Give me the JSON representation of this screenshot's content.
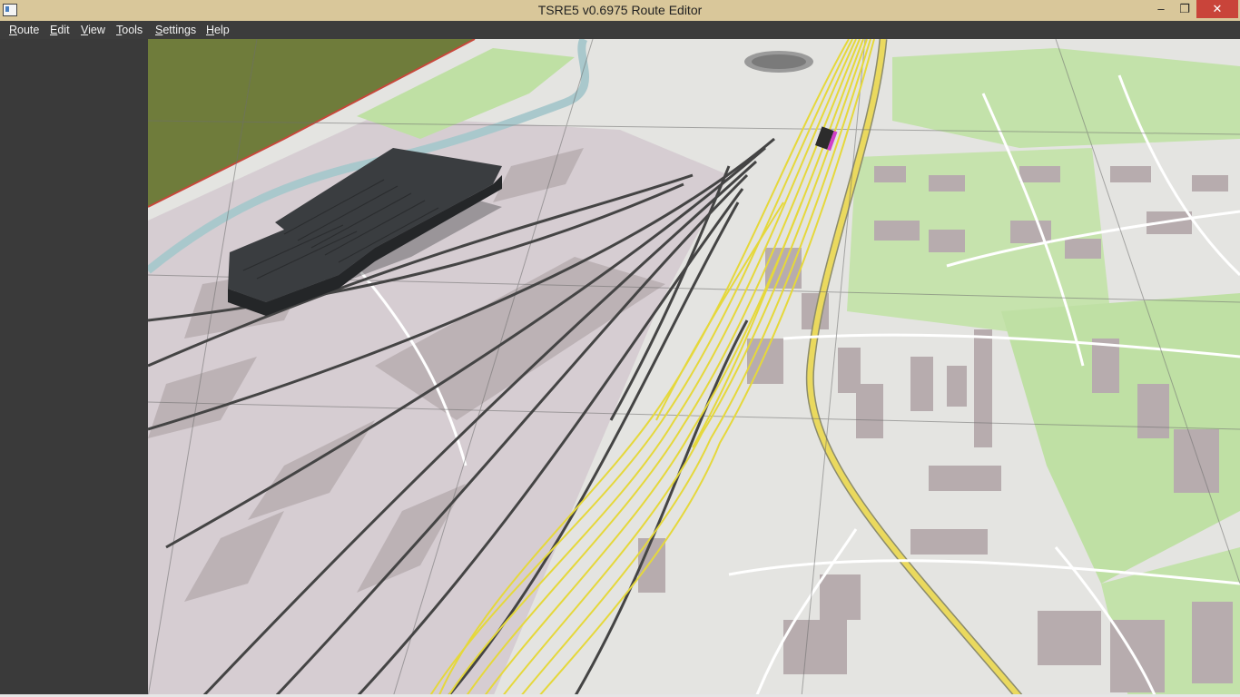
{
  "window": {
    "title": "TSRE5 v0.6975 Route Editor",
    "controls": {
      "minimize": "–",
      "maximize": "❐",
      "close": "✕"
    }
  },
  "menubar": {
    "items": [
      "Route",
      "Edit",
      "View",
      "Tools",
      "Settings",
      "Help"
    ]
  },
  "viewport": {
    "description_colors": {
      "terrain_grass": "#6d7a3a",
      "map_base": "#e4e4e1",
      "industrial": "#d5cbd0",
      "building": "#b5aaad",
      "park": "#b8dc9c",
      "water": "#a8c8cc",
      "road_major": "#e8dc5c",
      "track": "#4a4a4a",
      "track_selected": "#e6d83a",
      "hall_roof": "#3a3d40"
    }
  }
}
